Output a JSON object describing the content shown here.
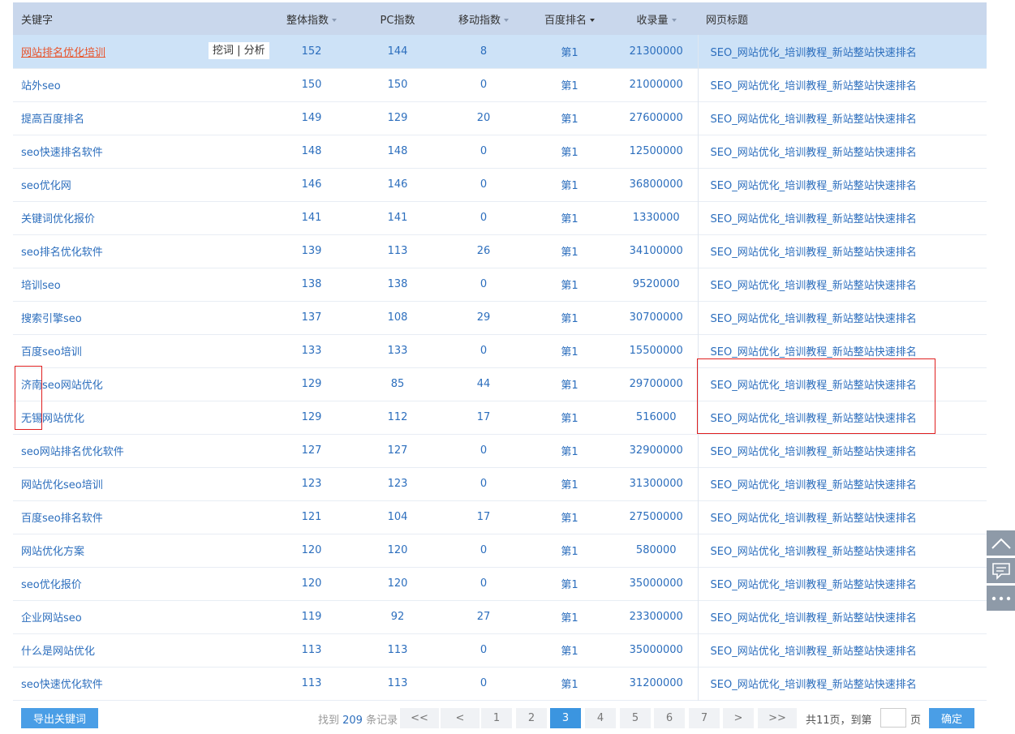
{
  "headers": {
    "keyword": "关键字",
    "overall": "整体指数",
    "pc": "PC指数",
    "mobile": "移动指数",
    "rank": "百度排名",
    "indexed": "收录量",
    "title": "网页标题"
  },
  "row_actions": {
    "dig": "挖词",
    "sep": " | ",
    "analyze": "分析"
  },
  "rows": [
    {
      "kw": "网站排名优化培训",
      "overall": "152",
      "pc": "144",
      "mobile": "8",
      "rank": "第1",
      "indexed": "21300000",
      "title": "SEO_网站优化_培训教程_新站整站快速排名"
    },
    {
      "kw": "站外seo",
      "overall": "150",
      "pc": "150",
      "mobile": "0",
      "rank": "第1",
      "indexed": "21000000",
      "title": "SEO_网站优化_培训教程_新站整站快速排名"
    },
    {
      "kw": "提高百度排名",
      "overall": "149",
      "pc": "129",
      "mobile": "20",
      "rank": "第1",
      "indexed": "27600000",
      "title": "SEO_网站优化_培训教程_新站整站快速排名"
    },
    {
      "kw": "seo快速排名软件",
      "overall": "148",
      "pc": "148",
      "mobile": "0",
      "rank": "第1",
      "indexed": "12500000",
      "title": "SEO_网站优化_培训教程_新站整站快速排名"
    },
    {
      "kw": "seo优化网",
      "overall": "146",
      "pc": "146",
      "mobile": "0",
      "rank": "第1",
      "indexed": "36800000",
      "title": "SEO_网站优化_培训教程_新站整站快速排名"
    },
    {
      "kw": "关键词优化报价",
      "overall": "141",
      "pc": "141",
      "mobile": "0",
      "rank": "第1",
      "indexed": "1330000",
      "title": "SEO_网站优化_培训教程_新站整站快速排名"
    },
    {
      "kw": "seo排名优化软件",
      "overall": "139",
      "pc": "113",
      "mobile": "26",
      "rank": "第1",
      "indexed": "34100000",
      "title": "SEO_网站优化_培训教程_新站整站快速排名"
    },
    {
      "kw": "培训seo",
      "overall": "138",
      "pc": "138",
      "mobile": "0",
      "rank": "第1",
      "indexed": "9520000",
      "title": "SEO_网站优化_培训教程_新站整站快速排名"
    },
    {
      "kw": "搜索引擎seo",
      "overall": "137",
      "pc": "108",
      "mobile": "29",
      "rank": "第1",
      "indexed": "30700000",
      "title": "SEO_网站优化_培训教程_新站整站快速排名"
    },
    {
      "kw": "百度seo培训",
      "overall": "133",
      "pc": "133",
      "mobile": "0",
      "rank": "第1",
      "indexed": "15500000",
      "title": "SEO_网站优化_培训教程_新站整站快速排名"
    },
    {
      "kw": "济南seo网站优化",
      "overall": "129",
      "pc": "85",
      "mobile": "44",
      "rank": "第1",
      "indexed": "29700000",
      "title": "SEO_网站优化_培训教程_新站整站快速排名"
    },
    {
      "kw": "无锡网站优化",
      "overall": "129",
      "pc": "112",
      "mobile": "17",
      "rank": "第1",
      "indexed": "516000",
      "title": "SEO_网站优化_培训教程_新站整站快速排名"
    },
    {
      "kw": "seo网站排名优化软件",
      "overall": "127",
      "pc": "127",
      "mobile": "0",
      "rank": "第1",
      "indexed": "32900000",
      "title": "SEO_网站优化_培训教程_新站整站快速排名"
    },
    {
      "kw": "网站优化seo培训",
      "overall": "123",
      "pc": "123",
      "mobile": "0",
      "rank": "第1",
      "indexed": "31300000",
      "title": "SEO_网站优化_培训教程_新站整站快速排名"
    },
    {
      "kw": "百度seo排名软件",
      "overall": "121",
      "pc": "104",
      "mobile": "17",
      "rank": "第1",
      "indexed": "27500000",
      "title": "SEO_网站优化_培训教程_新站整站快速排名"
    },
    {
      "kw": "网站优化方案",
      "overall": "120",
      "pc": "120",
      "mobile": "0",
      "rank": "第1",
      "indexed": "580000",
      "title": "SEO_网站优化_培训教程_新站整站快速排名"
    },
    {
      "kw": "seo优化报价",
      "overall": "120",
      "pc": "120",
      "mobile": "0",
      "rank": "第1",
      "indexed": "35000000",
      "title": "SEO_网站优化_培训教程_新站整站快速排名"
    },
    {
      "kw": "企业网站seo",
      "overall": "119",
      "pc": "92",
      "mobile": "27",
      "rank": "第1",
      "indexed": "23300000",
      "title": "SEO_网站优化_培训教程_新站整站快速排名"
    },
    {
      "kw": "什么是网站优化",
      "overall": "113",
      "pc": "113",
      "mobile": "0",
      "rank": "第1",
      "indexed": "35000000",
      "title": "SEO_网站优化_培训教程_新站整站快速排名"
    },
    {
      "kw": "seo快速优化软件",
      "overall": "113",
      "pc": "113",
      "mobile": "0",
      "rank": "第1",
      "indexed": "31200000",
      "title": "SEO_网站优化_培训教程_新站整站快速排名"
    }
  ],
  "footer": {
    "export_label": "导出关键词",
    "found_prefix": "找到 ",
    "found_count": "209",
    "found_suffix": " 条记录",
    "pages": [
      "<<",
      "<",
      "1",
      "2",
      "3",
      "4",
      "5",
      "6",
      "7",
      ">",
      ">>"
    ],
    "current_page": "3",
    "total_pages_text": "共11页，到第",
    "page_unit": "页",
    "confirm_label": "确定"
  },
  "icons": {
    "side_top": "chevron-up-icon",
    "side_feedback": "comment-icon",
    "side_more": "more-dots-icon"
  },
  "colors": {
    "header_bg": "#c9d7ec",
    "highlight_row": "#cde2f7",
    "link": "#2c6ebd",
    "active_keyword": "#e8532a",
    "button": "#4a9ee6",
    "annotation": "#e02020"
  }
}
